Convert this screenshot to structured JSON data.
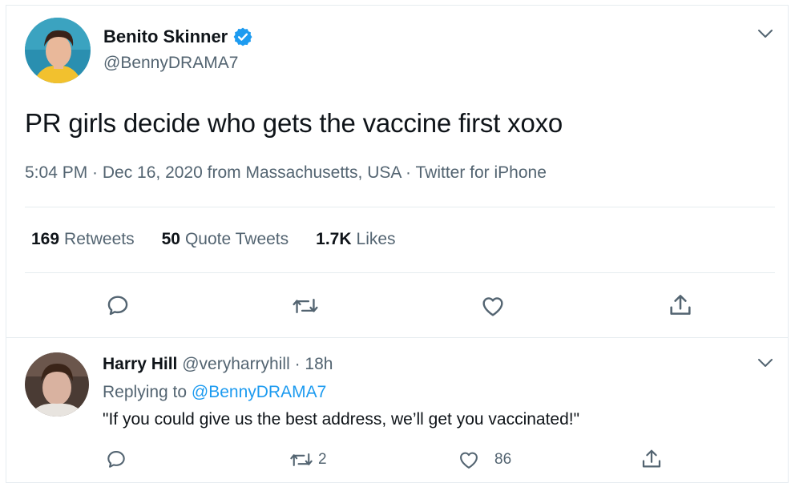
{
  "tweet": {
    "display_name": "Benito Skinner",
    "handle": "@BennyDRAMA7",
    "text": "PR girls decide who gets the vaccine first xoxo",
    "meta": "5:04 PM · Dec 16, 2020 from Massachusetts, USA · Twitter for iPhone",
    "stats": {
      "retweets_count": "169",
      "retweets_label": "Retweets",
      "quotes_count": "50",
      "quotes_label": "Quote Tweets",
      "likes_count": "1.7K",
      "likes_label": "Likes"
    },
    "actions": [
      "reply-icon",
      "retweet-icon",
      "like-icon",
      "share-icon"
    ]
  },
  "reply": {
    "display_name": "Harry Hill",
    "handle": "@veryharryhill",
    "separator": "·",
    "time": "18h",
    "replying_prefix": "Replying to",
    "replying_mention": "@BennyDRAMA7",
    "text": "\"If you could give us the best address, we’ll get you vaccinated!\"",
    "retweet_count": "2",
    "like_count": "86"
  },
  "colors": {
    "accent": "#1d9bf0",
    "secondary_text": "#536471",
    "primary_text": "#0f1419",
    "border": "#e6ecf0"
  }
}
